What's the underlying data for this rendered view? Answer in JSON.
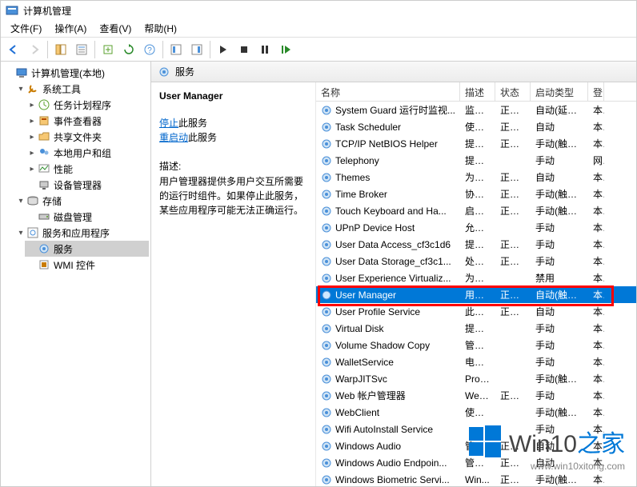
{
  "window": {
    "title": "计算机管理"
  },
  "menu": {
    "file": "文件(F)",
    "action": "操作(A)",
    "view": "查看(V)",
    "help": "帮助(H)"
  },
  "tree": {
    "root": "计算机管理(本地)",
    "systemTools": "系统工具",
    "taskScheduler": "任务计划程序",
    "eventViewer": "事件查看器",
    "sharedFolders": "共享文件夹",
    "localUsers": "本地用户和组",
    "performance": "性能",
    "deviceManager": "设备管理器",
    "storage": "存储",
    "diskMgmt": "磁盘管理",
    "servicesApps": "服务和应用程序",
    "services": "服务",
    "wmi": "WMI 控件"
  },
  "rightHeader": "服务",
  "detail": {
    "serviceName": "User Manager",
    "stopLink": "停止",
    "stopSuffix": "此服务",
    "restartLink": "重启动",
    "restartSuffix": "此服务",
    "descLabel": "描述:",
    "descText": "用户管理器提供多用户交互所需要的运行时组件。如果停止此服务，某些应用程序可能无法正确运行。"
  },
  "columns": {
    "name": "名称",
    "desc": "描述",
    "state": "状态",
    "start": "启动类型",
    "logon": "登"
  },
  "services": [
    {
      "name": "System Guard 运行时监视...",
      "desc": "监视...",
      "state": "正在...",
      "start": "自动(延迟...",
      "logon": "本"
    },
    {
      "name": "Task Scheduler",
      "desc": "使用...",
      "state": "正在...",
      "start": "自动",
      "logon": "本"
    },
    {
      "name": "TCP/IP NetBIOS Helper",
      "desc": "提供...",
      "state": "正在...",
      "start": "手动(触发...",
      "logon": "本"
    },
    {
      "name": "Telephony",
      "desc": "提供...",
      "state": "",
      "start": "手动",
      "logon": "网"
    },
    {
      "name": "Themes",
      "desc": "为用...",
      "state": "正在...",
      "start": "自动",
      "logon": "本"
    },
    {
      "name": "Time Broker",
      "desc": "协调...",
      "state": "正在...",
      "start": "手动(触发...",
      "logon": "本"
    },
    {
      "name": "Touch Keyboard and Ha...",
      "desc": "启用...",
      "state": "正在...",
      "start": "手动(触发...",
      "logon": "本"
    },
    {
      "name": "UPnP Device Host",
      "desc": "允许...",
      "state": "",
      "start": "手动",
      "logon": "本"
    },
    {
      "name": "User Data Access_cf3c1d6",
      "desc": "提供...",
      "state": "正在...",
      "start": "手动",
      "logon": "本"
    },
    {
      "name": "User Data Storage_cf3c1...",
      "desc": "处理...",
      "state": "正在...",
      "start": "手动",
      "logon": "本"
    },
    {
      "name": "User Experience Virtualiz...",
      "desc": "为应...",
      "state": "",
      "start": "禁用",
      "logon": "本"
    },
    {
      "name": "User Manager",
      "desc": "用户...",
      "state": "正在...",
      "start": "自动(触发...",
      "logon": "本",
      "selected": true
    },
    {
      "name": "User Profile Service",
      "desc": "此服...",
      "state": "正在...",
      "start": "自动",
      "logon": "本"
    },
    {
      "name": "Virtual Disk",
      "desc": "提供...",
      "state": "",
      "start": "手动",
      "logon": "本"
    },
    {
      "name": "Volume Shadow Copy",
      "desc": "管理...",
      "state": "",
      "start": "手动",
      "logon": "本"
    },
    {
      "name": "WalletService",
      "desc": "电子...",
      "state": "",
      "start": "手动",
      "logon": "本"
    },
    {
      "name": "WarpJITSvc",
      "desc": "Prov...",
      "state": "",
      "start": "手动(触发...",
      "logon": "本"
    },
    {
      "name": "Web 帐户管理器",
      "desc": "Web...",
      "state": "正在...",
      "start": "手动",
      "logon": "本"
    },
    {
      "name": "WebClient",
      "desc": "使基...",
      "state": "",
      "start": "手动(触发...",
      "logon": "本"
    },
    {
      "name": "Wifi AutoInstall Service",
      "desc": "",
      "state": "",
      "start": "手动",
      "logon": "本"
    },
    {
      "name": "Windows Audio",
      "desc": "管理...",
      "state": "正在...",
      "start": "自动",
      "logon": "本"
    },
    {
      "name": "Windows Audio Endpoin...",
      "desc": "管理...",
      "state": "正在...",
      "start": "自动",
      "logon": "本"
    },
    {
      "name": "Windows Biometric Servi...",
      "desc": "Win...",
      "state": "正在...",
      "start": "手动(触发...",
      "logon": "本"
    }
  ],
  "watermark": {
    "brand": "Win10",
    "suffix": "之家",
    "url": "www.win10xitong.com"
  }
}
